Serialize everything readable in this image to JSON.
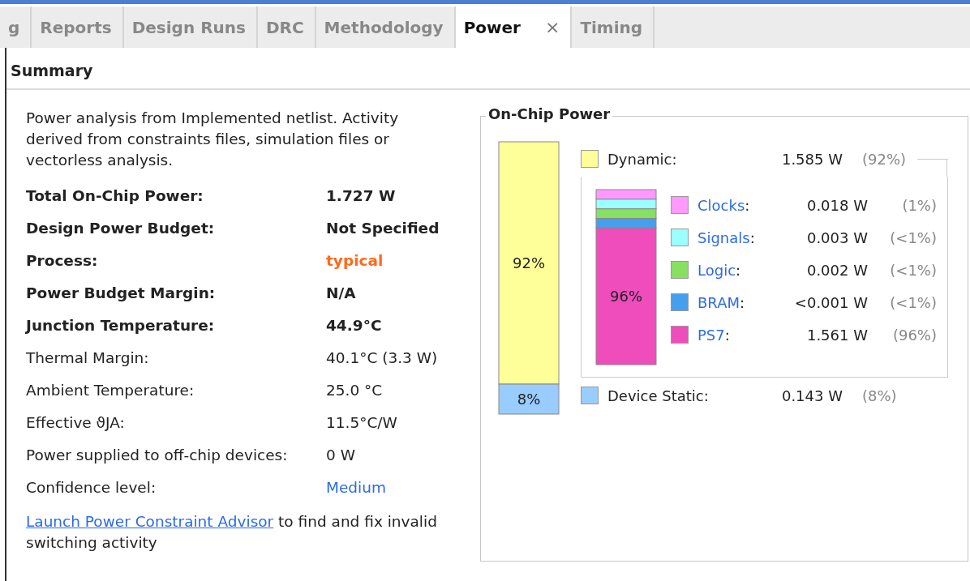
{
  "tabs": [
    {
      "label": "g",
      "selected": false
    },
    {
      "label": "Reports",
      "selected": false
    },
    {
      "label": "Design Runs",
      "selected": false
    },
    {
      "label": "DRC",
      "selected": false
    },
    {
      "label": "Methodology",
      "selected": false
    },
    {
      "label": "Power",
      "selected": true,
      "close": "×"
    },
    {
      "label": "Timing",
      "selected": false
    }
  ],
  "section_title": "Summary",
  "description": "Power analysis from Implemented netlist. Activity derived from constraints files, simulation files or vectorless analysis.",
  "properties": [
    {
      "label": "Total On-Chip Power:",
      "value": "1.727 W",
      "kind": "emphasis",
      "warning": false,
      "link": false
    },
    {
      "label": "Design Power Budget:",
      "value": "Not Specified",
      "kind": "emphasis",
      "warning": false,
      "link": false
    },
    {
      "label": "Process:",
      "value": "typical",
      "kind": "emphasis",
      "warning": true,
      "link": false
    },
    {
      "label": "Power Budget Margin:",
      "value": "N/A",
      "kind": "emphasis",
      "warning": false,
      "link": false
    },
    {
      "label": "Junction Temperature:",
      "value": "44.9°C",
      "kind": "emphasis",
      "warning": false,
      "link": false
    },
    {
      "label": "Thermal Margin:",
      "value": "40.1°C (3.3 W)",
      "kind": "normal",
      "warning": false,
      "link": false
    },
    {
      "label": "Ambient Temperature:",
      "value": "25.0 °C",
      "kind": "normal",
      "warning": false,
      "link": false
    },
    {
      "label": "Effective ϑJA:",
      "value": "11.5°C/W",
      "kind": "normal",
      "warning": false,
      "link": false
    },
    {
      "label": "Power supplied to off-chip devices:",
      "value": "0 W",
      "kind": "normal",
      "warning": false,
      "link": false
    },
    {
      "label": "Confidence level:",
      "value": "Medium",
      "kind": "normal",
      "warning": false,
      "link": true
    }
  ],
  "advisor": {
    "link": "Launch Power Constraint Advisor",
    "text": " to find and fix invalid switching activity"
  },
  "on_chip_power": {
    "title": "On-Chip Power",
    "outer_bar": [
      {
        "label": "92%",
        "level": 0.89,
        "color": "#ffff99"
      },
      {
        "label": "8%",
        "level": 0.11,
        "color": "#99ccff"
      }
    ],
    "dynamic": {
      "label": "Dynamic:",
      "value": "1.585 W",
      "percent": "(92%)",
      "color": "#ffff99"
    },
    "inner_bar": [
      {
        "color": "#ff99ff"
      },
      {
        "color": "#99ffff"
      },
      {
        "color": "#88e060"
      },
      {
        "color": "#44a0ee"
      },
      {
        "label": "96%",
        "level": 0.78,
        "color": "#ee4dbb"
      }
    ],
    "components": [
      {
        "label": "Clocks",
        "separator": ":",
        "value": "0.018 W",
        "percent": "(1%)",
        "color": "#ff99ff"
      },
      {
        "label": "Signals",
        "separator": ":",
        "value": "0.003 W",
        "percent": "(<1%)",
        "color": "#99ffff"
      },
      {
        "label": "Logic",
        "separator": ":",
        "value": "0.002 W",
        "percent": "(<1%)",
        "color": "#88e060"
      },
      {
        "label": "BRAM",
        "separator": ":",
        "value": "<0.001 W",
        "percent": "(<1%)",
        "color": "#44a0ee"
      },
      {
        "label": "PS7",
        "separator": ":",
        "value": "1.561 W",
        "percent": "(96%)",
        "color": "#ee4dbb"
      }
    ],
    "static": {
      "label": "Device Static:",
      "value": "0.143 W",
      "percent": "(8%)",
      "color": "#99ccff"
    }
  }
}
